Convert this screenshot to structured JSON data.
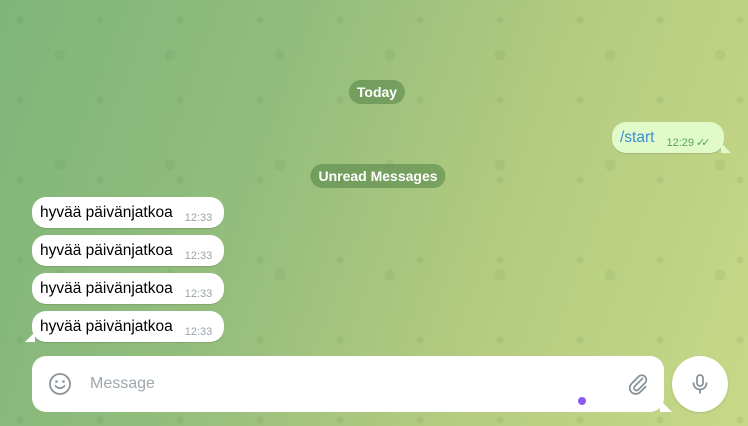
{
  "chat": {
    "date_label": "Today",
    "unread_label": "Unread Messages",
    "outgoing": [
      {
        "text": "/start",
        "time": "12:29",
        "read": true
      }
    ],
    "incoming": [
      {
        "text": "hyvää päivänjatkoa",
        "time": "12:33"
      },
      {
        "text": "hyvää päivänjatkoa",
        "time": "12:33"
      },
      {
        "text": "hyvää päivänjatkoa",
        "time": "12:33"
      },
      {
        "text": "hyvää päivänjatkoa",
        "time": "12:33"
      }
    ]
  },
  "composer": {
    "placeholder": "Message",
    "value": "",
    "icons": {
      "emoji": "smile-icon",
      "attach": "paperclip-icon",
      "mic": "microphone-icon"
    },
    "indicator_color": "#8a5cf0"
  },
  "colors": {
    "outgoing_bubble": "#e1fac9",
    "command_link": "#3a8fd3",
    "read_check": "#4fa355"
  }
}
